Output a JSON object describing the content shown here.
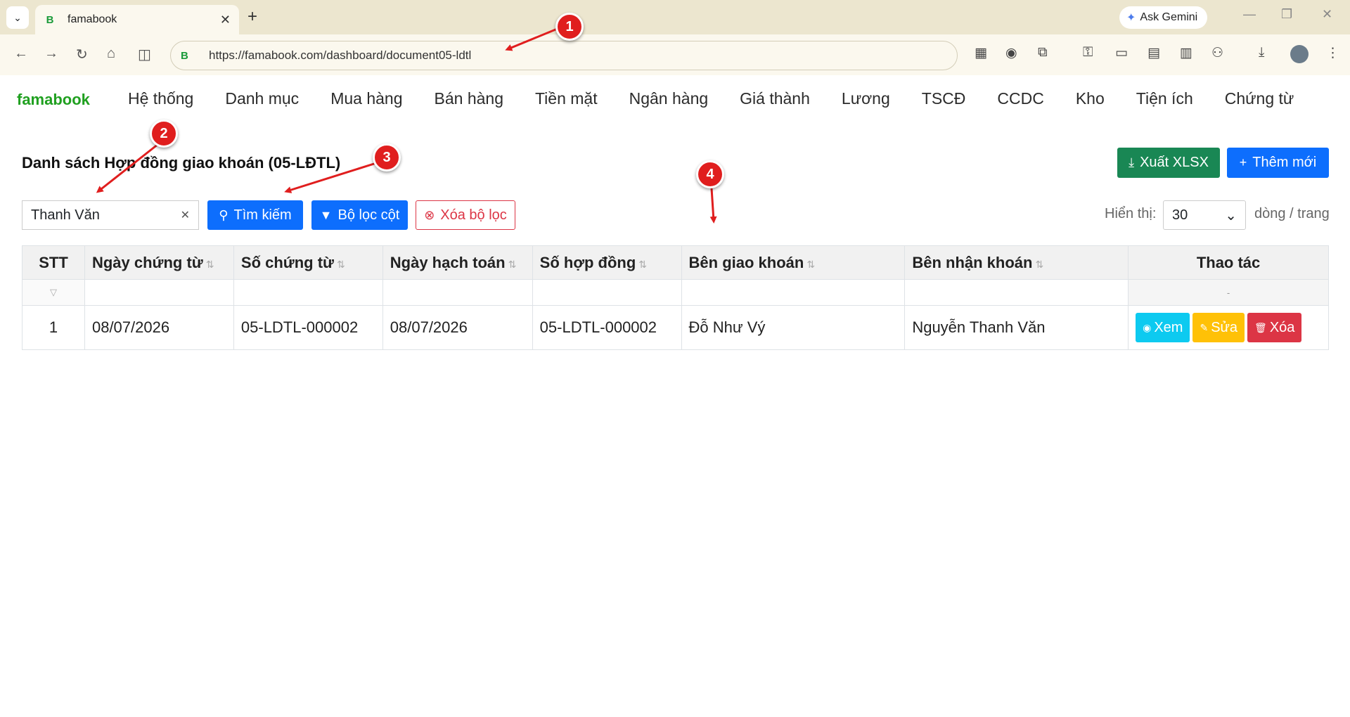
{
  "browser": {
    "tab_title": "famabook",
    "tab_favicon": "B",
    "url": "https://famabook.com/dashboard/document05-ldtl",
    "gemini_label": "Ask Gemini"
  },
  "app": {
    "brand": "famabook",
    "menu": [
      "Hệ thống",
      "Danh mục",
      "Mua hàng",
      "Bán hàng",
      "Tiền mặt",
      "Ngân hàng",
      "Giá thành",
      "Lương",
      "TSCĐ",
      "CCDC",
      "Kho",
      "Tiện ích",
      "Chứng từ"
    ]
  },
  "page": {
    "title": "Danh sách Hợp đồng giao khoán (05-LĐTL)",
    "export_label": "Xuất XLSX",
    "add_label": "Thêm mới",
    "search_value": "Thanh Văn",
    "search_label": "Tìm kiếm",
    "col_filter_label": "Bộ lọc cột",
    "clear_filter_label": "Xóa bộ lọc",
    "pager_label": "Hiển thị:",
    "pager_value": "30",
    "pager_unit": "dòng / trang"
  },
  "table": {
    "headers": [
      "STT",
      "Ngày chứng từ",
      "Số chứng từ",
      "Ngày hạch toán",
      "Số hợp đồng",
      "Bên giao khoán",
      "Bên nhận khoán",
      "Thao tác"
    ],
    "filter_last": "-",
    "rows": [
      {
        "stt": "1",
        "ngay_ct": "08/07/2026",
        "so_ct": "05-LDTL-000002",
        "ngay_ht": "08/07/2026",
        "so_hd": "05-LDTL-000002",
        "ben_giao": "Đỗ Như Vý",
        "ben_nhan": "Nguyễn Thanh Văn"
      }
    ],
    "actions": {
      "view": "Xem",
      "edit": "Sửa",
      "delete": "Xóa"
    }
  },
  "annotations": [
    "1",
    "2",
    "3",
    "4"
  ],
  "colors": {
    "primary": "#0d6efd",
    "success": "#198754",
    "danger": "#dc3545",
    "info": "#0dcaf0",
    "warning": "#ffc107",
    "brand": "#20a020",
    "annotation": "#e01e1e"
  }
}
